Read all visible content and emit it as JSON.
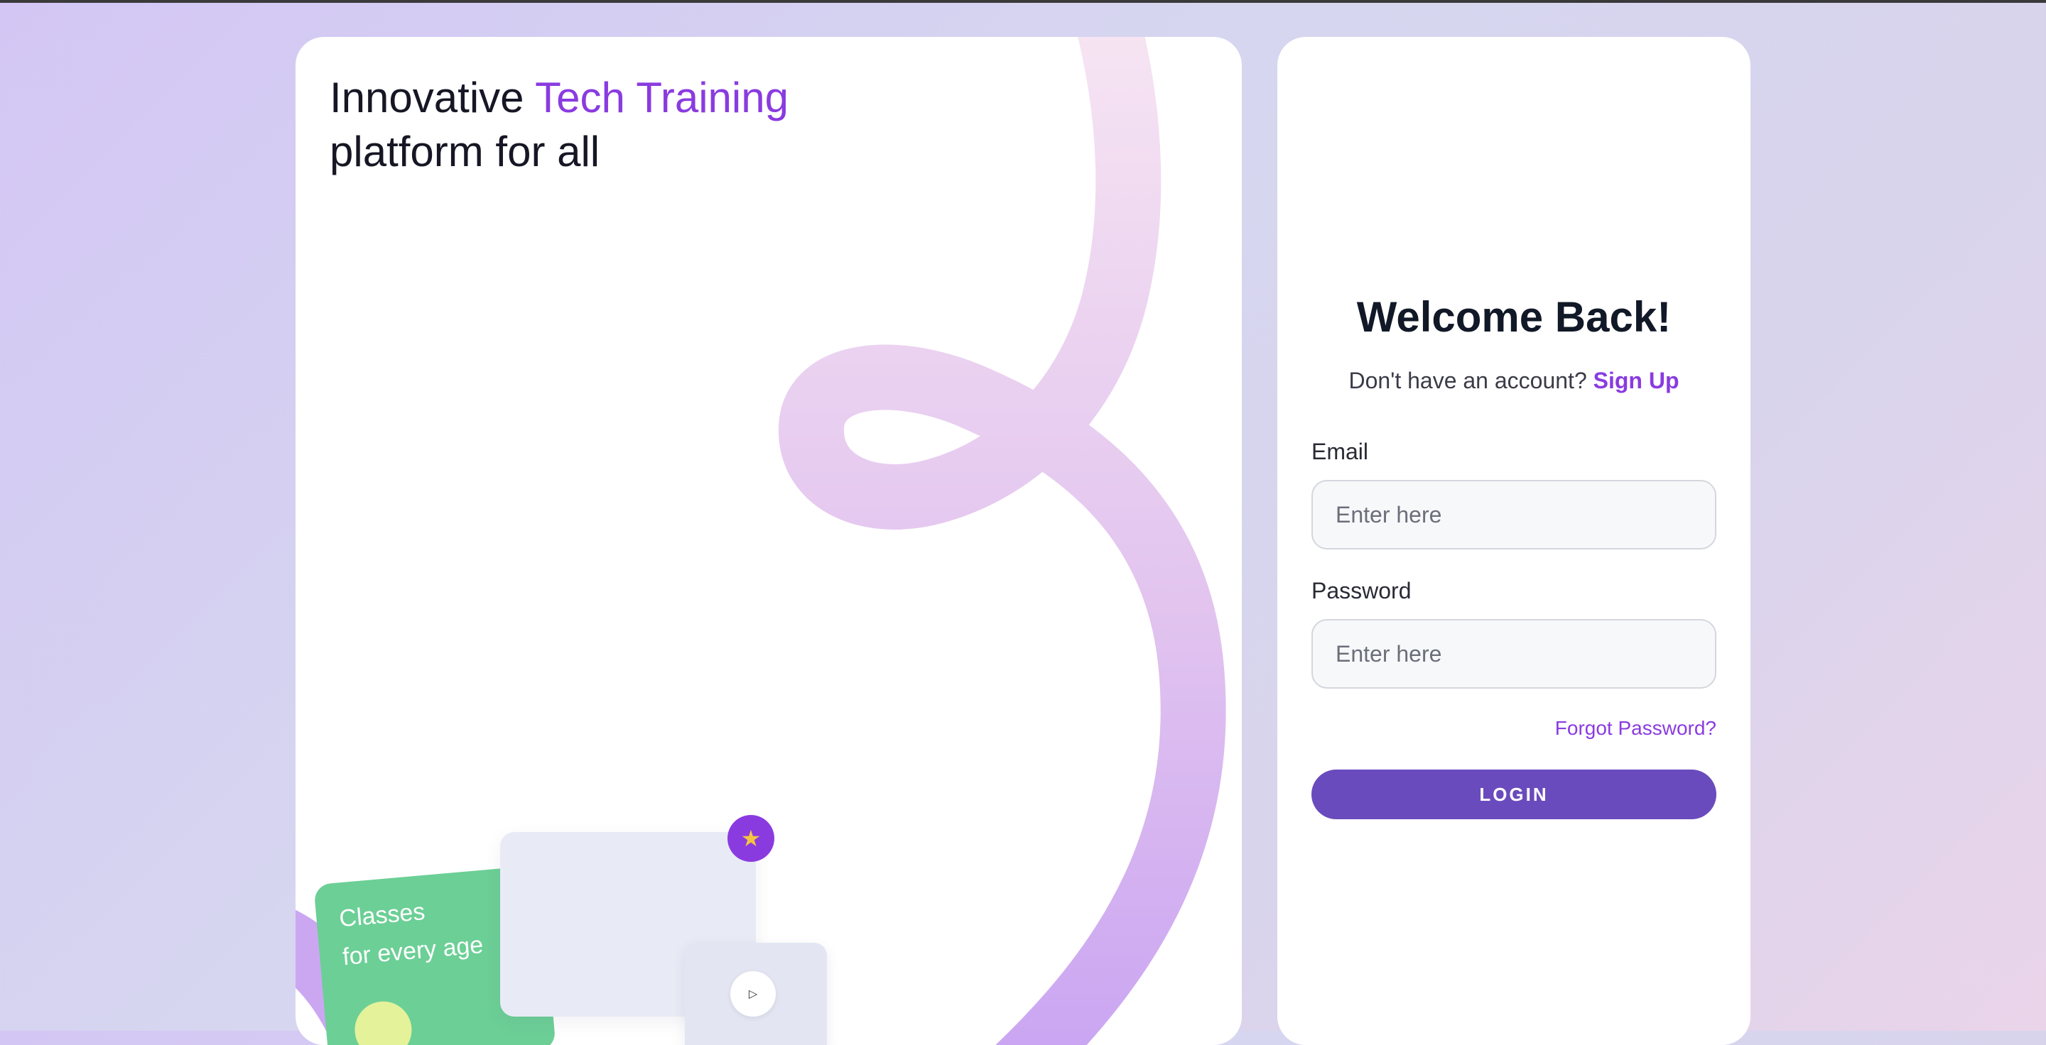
{
  "hero": {
    "title_part1": "Innovative ",
    "title_accent": "Tech Training",
    "title_part2": "platform for all",
    "green_card": {
      "line1": "Classes",
      "line2": "for every age"
    },
    "star_icon": "star-icon",
    "play_icon": "play-icon"
  },
  "login": {
    "heading": "Welcome Back!",
    "signup_prompt": "Don't have an account? ",
    "signup_link": "Sign Up",
    "email_label": "Email",
    "email_placeholder": "Enter here",
    "password_label": "Password",
    "password_placeholder": "Enter here",
    "forgot_link": "Forgot Password?",
    "login_button": "LOGIN"
  },
  "colors": {
    "accent": "#8a3be0",
    "button": "#6a4bbd",
    "green_card": "#6ccf96",
    "swirl_start": "#f5e2f2",
    "swirl_end": "#cba7f2"
  }
}
